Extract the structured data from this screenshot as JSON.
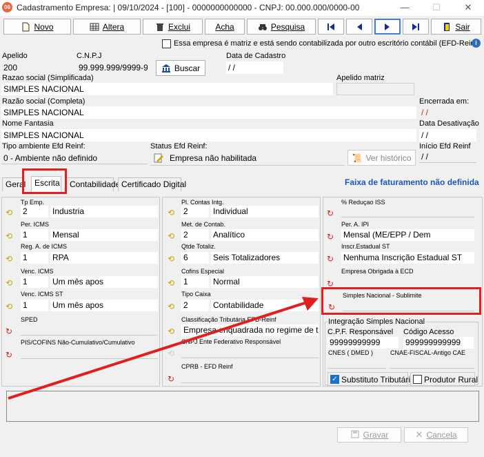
{
  "window": {
    "title": "Cadastramento Empresa: |  09/10/2024 - [100] - 0000000000000 - CNPJ: 00.000.000/0000-00",
    "app_icon_text": "06",
    "minimize": "—",
    "maximize": "☐",
    "close": "✕"
  },
  "toolbar": {
    "novo": "Novo",
    "altera": "Altera",
    "exclui": "Exclui",
    "acha": "Acha",
    "pesquisa": "Pesquisa",
    "sair": "Sair"
  },
  "header": {
    "matriz_checkbox": "Essa empresa é matriz e está sendo contabilizada por outro escritório contábil (EFD-Reinf)",
    "apelido_label": "Apelido",
    "apelido": "200",
    "cnpj_label": "C.N.P.J",
    "cnpj": "99.999.999/9999-99",
    "buscar": "Buscar",
    "data_cadastro_label": "Data de Cadastro",
    "data_cadastro": " /  /",
    "razao_simpl_label": "Razao social (Simplificada)",
    "razao_simpl": "SIMPLES NACIONAL",
    "apelido_matriz_label": "Apelido matriz",
    "razao_comp_label": "Razão social (Completa)",
    "razao_comp": "SIMPLES NACIONAL",
    "encerrada_label": "Encerrada em:",
    "encerrada": " /  /",
    "nome_fantasia_label": "Nome Fantasia",
    "nome_fantasia": "SIMPLES NACIONAL",
    "data_desativacao_label": "Data Desativação",
    "data_desativacao": " /  /",
    "tipo_ambiente_label": "Tipo ambiente Efd Reinf:",
    "tipo_ambiente": "0 - Ambiente não definido",
    "status_efd_label": "Status Efd Reinf:",
    "status_efd": "Empresa não habilitada",
    "ver_historico": "Ver histórico",
    "inicio_efd_label": "Início Efd Reinf",
    "inicio_efd": " /  /"
  },
  "tabs": [
    "Geral",
    "Escrita",
    "Contabilidade",
    "Certificado Digital"
  ],
  "faixa": "Faixa de faturamento não definida",
  "col1": {
    "tp_emp_label": "Tp Emp.",
    "tp_emp_code": "2",
    "tp_emp": "Industria",
    "per_icms_label": "Per. ICMS",
    "per_icms_code": "1",
    "per_icms": "Mensal",
    "reg_icms_label": "Reg. A. de ICMS",
    "reg_icms_code": "1",
    "reg_icms": "RPA",
    "venc_icms_label": "Venc. ICMS",
    "venc_icms_code": "1",
    "venc_icms": "Um mês apos",
    "venc_icms_st_label": "Venc. ICMS ST",
    "venc_icms_st_code": "1",
    "venc_icms_st": "Um mês apos",
    "sped_label": "SPED",
    "pis_label": "PIS/COFINS Não-Cumulativo/Cumulativo"
  },
  "col2": {
    "pl_contas_label": "Pl. Contas Intg.",
    "pl_contas_code": "2",
    "pl_contas": "Individual",
    "met_contab_label": "Met. de Contab.",
    "met_contab_code": "2",
    "met_contab": "Analítico",
    "qtde_label": "Qtde Totaliz.",
    "qtde_code": "6",
    "qtde": "Seis Totalizadores",
    "cofins_label": "Cofins Especial",
    "cofins_code": "1",
    "cofins": "Normal",
    "tipo_caixa_label": "Tipo Caixa",
    "tipo_caixa_code": "2",
    "tipo_caixa": "Contabilidade",
    "class_trib_label": "Classificação Tributária EFD-Reinf",
    "class_trib": "Empresa enquadrada no regime de tributação",
    "cnpj_ente_label": "CNPJ Ente Federativo Responsável",
    "cprb_label": "CPRB - EFD Reinf"
  },
  "col3": {
    "reducao_label": "% Reduçao ISS",
    "per_ipi_label": "Per. A.  IPI",
    "per_ipi": "Mensal (ME/EPP / Dem",
    "inscr_st_label": "Inscr.Estadual ST",
    "inscr_st": "Nenhuma Inscrição Estadual ST",
    "ecd_label": "Empresa Obrigada à ECD",
    "sublimite_label": "Simples Nacional - Sublimite",
    "integracao_label": "Integração Simples Nacional",
    "cpf_resp_label": "C.P.F. Responsável",
    "cpf_resp": "99999999999",
    "cod_acesso_label": "Código Acesso",
    "cod_acesso": "999999999999",
    "cnes_label": "CNES ( DMED )",
    "cnae_label": "CNAE-FISCAL-Antigo CAE",
    "substituto_label": "Substituto Tributário",
    "produtor_label": "Produtor Rural"
  },
  "footer": {
    "gravar": "Gravar",
    "cancela": "Cancela"
  }
}
